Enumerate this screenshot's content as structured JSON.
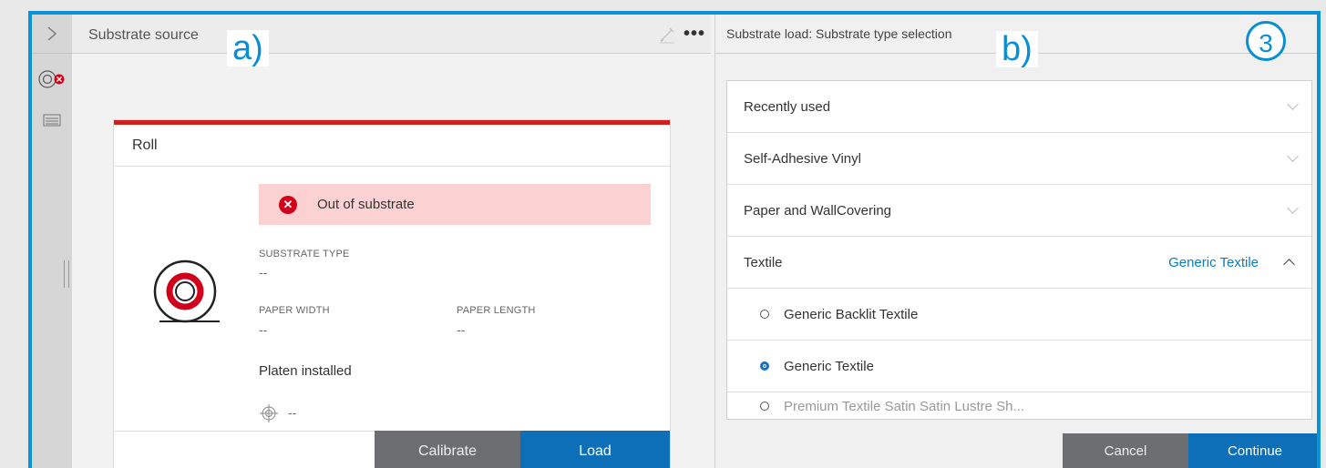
{
  "markers": {
    "a": "a)",
    "b": "b)",
    "step": "3"
  },
  "left_panel": {
    "title": "Substrate source",
    "more_label": "•••",
    "card": {
      "title": "Roll",
      "alert_text": "Out of substrate",
      "substrate_type_label": "SUBSTRATE TYPE",
      "substrate_type_value": "--",
      "paper_width_label": "PAPER WIDTH",
      "paper_width_value": "--",
      "paper_length_label": "PAPER LENGTH",
      "paper_length_value": "--",
      "platen": "Platen installed",
      "target_value": "--",
      "calibrate_label": "Calibrate",
      "load_label": "Load"
    }
  },
  "right_panel": {
    "title": "Substrate load: Substrate type selection",
    "categories": [
      {
        "label": "Recently used"
      },
      {
        "label": "Self-Adhesive Vinyl"
      },
      {
        "label": "Paper and  WallCovering"
      },
      {
        "label": "Textile",
        "selected": "Generic Textile"
      }
    ],
    "options": [
      {
        "label": "Generic Backlit Textile",
        "checked": false
      },
      {
        "label": "Generic Textile",
        "checked": true
      },
      {
        "label": "Premium Textile Satin Satin Lustre Sh...",
        "checked": false
      }
    ],
    "cancel_label": "Cancel",
    "continue_label": "Continue"
  },
  "colors": {
    "accent": "#0d6fb8",
    "alert_bg": "#fcd1d1",
    "error": "#d0021b",
    "frame": "#0a93d6"
  }
}
